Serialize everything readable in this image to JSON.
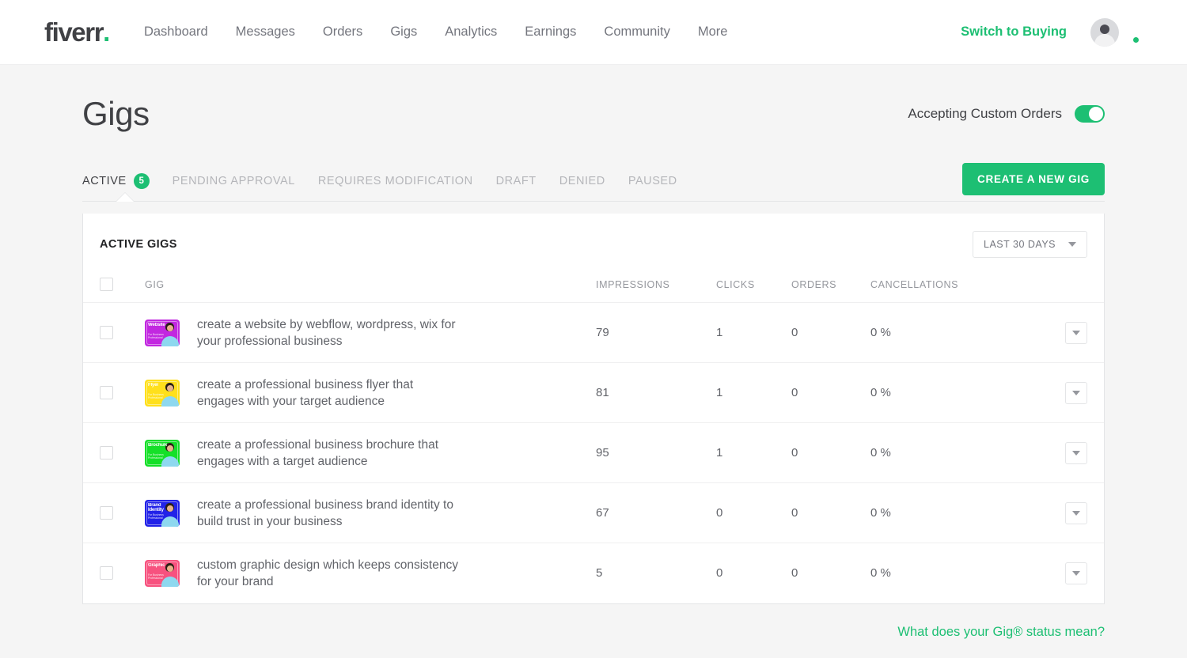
{
  "header": {
    "logo_text": "fiverr",
    "logo_dot": ".",
    "nav": [
      {
        "label": "Dashboard",
        "name": "nav-dashboard"
      },
      {
        "label": "Messages",
        "name": "nav-messages"
      },
      {
        "label": "Orders",
        "name": "nav-orders"
      },
      {
        "label": "Gigs",
        "name": "nav-gigs"
      },
      {
        "label": "Analytics",
        "name": "nav-analytics"
      },
      {
        "label": "Earnings",
        "name": "nav-earnings"
      },
      {
        "label": "Community",
        "name": "nav-community"
      },
      {
        "label": "More",
        "name": "nav-more"
      }
    ],
    "switch_label": "Switch to Buying",
    "avatar_icon": "user-avatar-icon",
    "status_icon": "online-status-dot-icon"
  },
  "page": {
    "title": "Gigs",
    "accepting_label": "Accepting Custom Orders",
    "accepting_on": true
  },
  "tabs": [
    {
      "label": "ACTIVE",
      "badge": "5",
      "active": true
    },
    {
      "label": "PENDING APPROVAL",
      "badge": "",
      "active": false
    },
    {
      "label": "REQUIRES MODIFICATION",
      "badge": "",
      "active": false
    },
    {
      "label": "DRAFT",
      "badge": "",
      "active": false
    },
    {
      "label": "DENIED",
      "badge": "",
      "active": false
    },
    {
      "label": "PAUSED",
      "badge": "",
      "active": false
    }
  ],
  "create_button_label": "CREATE A NEW GIG",
  "card": {
    "title": "ACTIVE GIGS",
    "range_selected": "LAST 30 DAYS",
    "range_caret_icon": "chevron-down-icon",
    "columns": [
      "GIG",
      "IMPRESSIONS",
      "CLICKS",
      "ORDERS",
      "CANCELLATIONS"
    ],
    "rows": [
      {
        "title": "create a website by webflow, wordpress, wix for your professional business",
        "impressions": "79",
        "clicks": "1",
        "orders": "0",
        "cancellations": "0 %",
        "thumb": {
          "bg": "#c228e0",
          "title": "Website",
          "sub": "Design",
          "caption": "For Business Professional"
        }
      },
      {
        "title": "create a professional business flyer that engages with your target audience",
        "impressions": "81",
        "clicks": "1",
        "orders": "0",
        "cancellations": "0 %",
        "thumb": {
          "bg": "#ffe01b",
          "title": "Flyer",
          "sub": "Design",
          "caption": "For Business Professional"
        }
      },
      {
        "title": "create a professional business brochure that engages with a target audience",
        "impressions": "95",
        "clicks": "1",
        "orders": "0",
        "cancellations": "0 %",
        "thumb": {
          "bg": "#15e028",
          "title": "Brochure",
          "sub": "Design",
          "caption": "For Business Professional"
        }
      },
      {
        "title": "create a professional business brand identity to build trust in your business",
        "impressions": "67",
        "clicks": "0",
        "orders": "0",
        "cancellations": "0 %",
        "thumb": {
          "bg": "#2222e8",
          "title": "Brand Identity",
          "sub": "",
          "caption": "For Business Professional"
        }
      },
      {
        "title": "custom graphic design which keeps consistency for your brand",
        "impressions": "5",
        "clicks": "0",
        "orders": "0",
        "cancellations": "0 %",
        "thumb": {
          "bg": "#f7527f",
          "title": "Graphic",
          "sub": "Design",
          "caption": "For Business Professional"
        }
      }
    ]
  },
  "footer": {
    "link_label": "What does your Gig® status mean?"
  },
  "colors": {
    "brand_green": "#1dbf73",
    "text_dark": "#404145",
    "text_muted": "#74767e",
    "text_light": "#95979d",
    "border": "#e4e5e7",
    "page_bg": "#f5f5f5"
  }
}
